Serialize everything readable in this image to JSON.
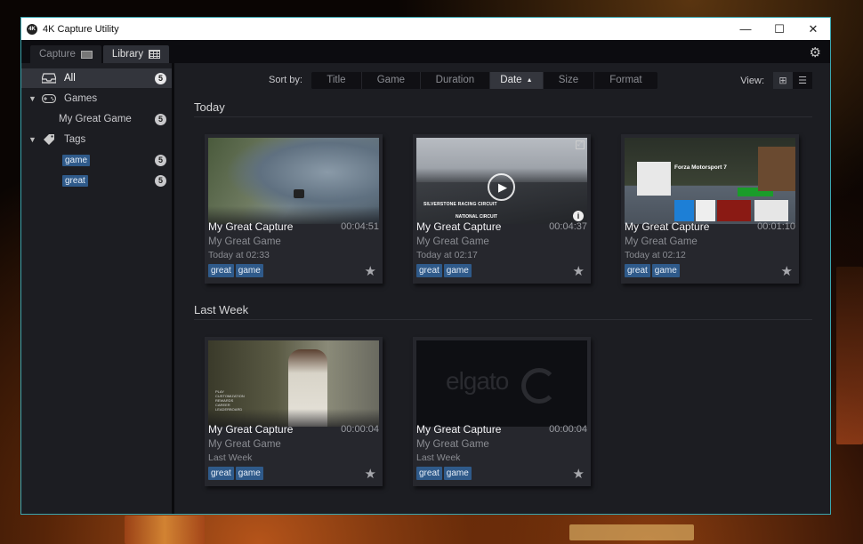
{
  "window": {
    "title": "4K Capture Utility",
    "logo_text": "4K",
    "controls": {
      "minimize": "—",
      "maximize": "☐",
      "close": "✕"
    }
  },
  "tabs": [
    {
      "label": "Capture",
      "active": false
    },
    {
      "label": "Library",
      "active": true
    }
  ],
  "sidebar": {
    "all": {
      "label": "All",
      "count": "5"
    },
    "games": {
      "label": "Games",
      "items": [
        {
          "label": "My Great Game",
          "count": "5"
        }
      ]
    },
    "tags": {
      "label": "Tags",
      "items": [
        {
          "label": "game",
          "count": "5"
        },
        {
          "label": "great",
          "count": "5"
        }
      ]
    }
  },
  "sortbar": {
    "label": "Sort by:",
    "options": [
      {
        "label": "Title"
      },
      {
        "label": "Game"
      },
      {
        "label": "Duration"
      },
      {
        "label": "Date",
        "active": true,
        "arrow": "▲"
      },
      {
        "label": "Size"
      },
      {
        "label": "Format"
      }
    ],
    "view_label": "View:",
    "view_grid_icon": "⊞",
    "view_list_icon": "☰"
  },
  "sections": [
    {
      "title": "Today",
      "cards": [
        {
          "title": "My Great Capture",
          "duration": "00:04:51",
          "game": "My Great Game",
          "date": "Today at 02:33",
          "tags": [
            "great",
            "game"
          ]
        },
        {
          "title": "My Great Capture",
          "duration": "00:04:37",
          "game": "My Great Game",
          "date": "Today at 02:17",
          "tags": [
            "great",
            "game"
          ]
        },
        {
          "title": "My Great Capture",
          "duration": "00:01:10",
          "game": "My Great Game",
          "date": "Today at 02:12",
          "tags": [
            "great",
            "game"
          ]
        }
      ]
    },
    {
      "title": "Last Week",
      "cards": [
        {
          "title": "My Great Capture",
          "duration": "00:00:04",
          "game": "My Great Game",
          "date": "Last Week",
          "tags": [
            "great",
            "game"
          ]
        },
        {
          "title": "My Great Capture",
          "duration": "00:00:04",
          "game": "My Great Game",
          "date": "Last Week",
          "tags": [
            "great",
            "game"
          ]
        }
      ]
    }
  ],
  "thumbnails": {
    "forza_title": "Forza Motorsport 7",
    "circuit_1": "SILVERSTONE RACING CIRCUIT",
    "circuit_2": "NATIONAL CIRCUIT",
    "elgato_text": "elgato"
  },
  "colors": {
    "accent_border": "#3aa6b0",
    "tag_bg": "#2f5a8a",
    "window_bg": "#1c1d22"
  }
}
